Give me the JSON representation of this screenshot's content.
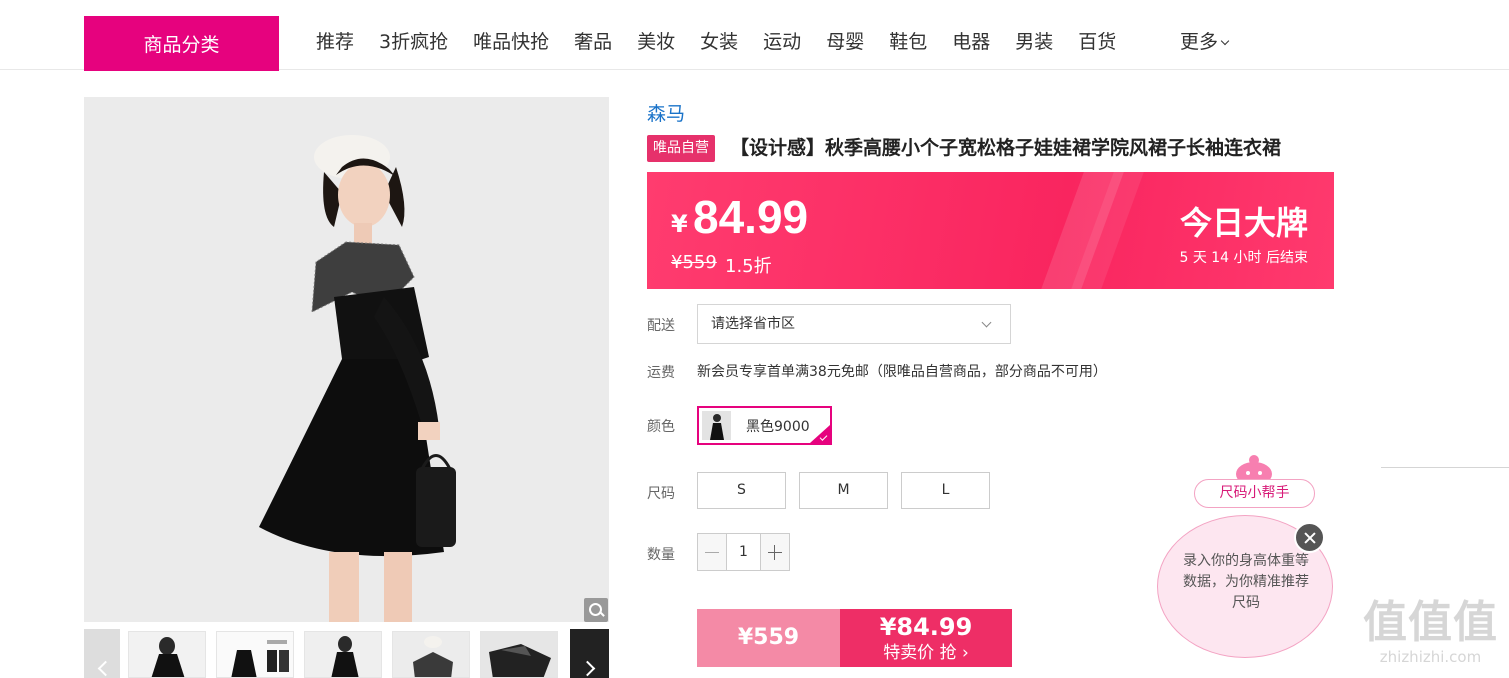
{
  "nav": {
    "category_button": "商品分类",
    "items": [
      "推荐",
      "3折疯抢",
      "唯品快抢",
      "奢品",
      "美妆",
      "女装",
      "运动",
      "母婴",
      "鞋包",
      "电器",
      "男装",
      "百货"
    ],
    "more": "更多"
  },
  "product": {
    "brand": "森马",
    "self_tag": "唯品自营",
    "title": "【设计感】秋季高腰小个子宽松格子娃娃裙学院风裙子长袖连衣裙"
  },
  "price": {
    "currency": "¥",
    "current": "84.99",
    "original": "¥559",
    "discount": "1.5折",
    "promo_title": "今日大牌",
    "countdown": "5 天 14 小时 后结束"
  },
  "delivery": {
    "label": "配送",
    "placeholder": "请选择省市区"
  },
  "shipping": {
    "label": "运费",
    "text": "新会员专享首单满38元免邮（限唯品自营商品，部分商品不可用）"
  },
  "color": {
    "label": "颜色",
    "selected": "黑色9000"
  },
  "size": {
    "label": "尺码",
    "options": [
      "S",
      "M",
      "L"
    ]
  },
  "quantity": {
    "label": "数量",
    "value": "1"
  },
  "buy": {
    "original_price": "¥559",
    "price": "¥84.99",
    "action": "特卖价 抢"
  },
  "size_helper": {
    "title": "尺码小帮手",
    "text": "录入你的身高体重等数据，为你精准推荐尺码"
  },
  "watermark": {
    "logo": "值值值",
    "url": "zhizhizhi.com"
  },
  "colors": {
    "brand_pink": "#e6027e",
    "price_red": "#f9255f",
    "link_blue": "#1a73c9"
  }
}
